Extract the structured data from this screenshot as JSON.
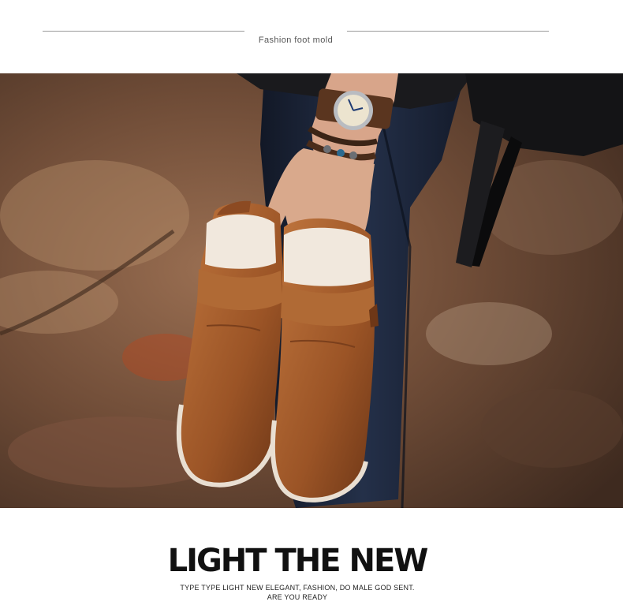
{
  "header": {
    "caption": "Fashion foot mold"
  },
  "photo": {
    "subject": "hand holding brown leather fur-lined slip-on shoes",
    "colors": {
      "ground": "#6b4a35",
      "leather": "#a85f2c",
      "fur": "#efe6dc",
      "denim": "#1c2433"
    }
  },
  "footer": {
    "headline": "LIGHT THE NEW",
    "tagline_line1": "TYPE TYPE LIGHT NEW ELEGANT, FASHION, DO MALE GOD SENT.",
    "tagline_line2": "ARE YOU READY"
  }
}
